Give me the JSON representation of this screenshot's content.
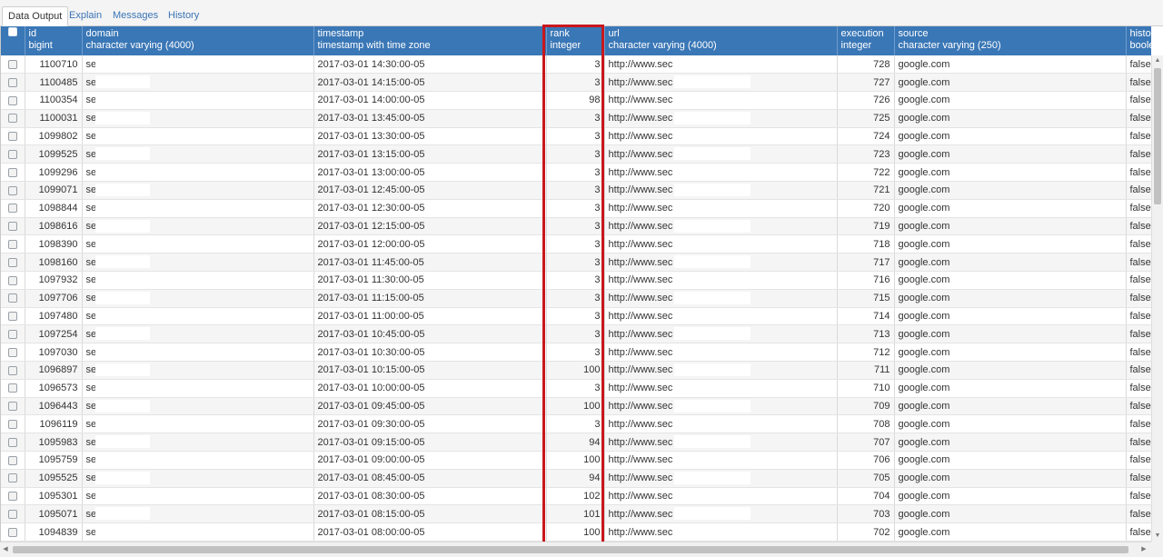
{
  "tabs": [
    {
      "label": "Data Output",
      "active": true
    },
    {
      "label": "Explain",
      "active": false
    },
    {
      "label": "Messages",
      "active": false
    },
    {
      "label": "History",
      "active": false
    }
  ],
  "columns": [
    {
      "name": "id",
      "type": "bigint"
    },
    {
      "name": "domain",
      "type": "character varying (4000)"
    },
    {
      "name": "timestamp",
      "type": "timestamp with time zone"
    },
    {
      "name": "rank",
      "type": "integer"
    },
    {
      "name": "url",
      "type": "character varying (4000)"
    },
    {
      "name": "execution",
      "type": "integer"
    },
    {
      "name": "source",
      "type": "character varying (250)"
    },
    {
      "name": "historica",
      "type": "boolean"
    }
  ],
  "rows": [
    [
      "1100710",
      "se",
      "2017-03-01 14:30:00-05",
      "3",
      "http://www.sec",
      "728",
      "google.com",
      "false"
    ],
    [
      "1100485",
      "se",
      "2017-03-01 14:15:00-05",
      "3",
      "http://www.sec",
      "727",
      "google.com",
      "false"
    ],
    [
      "1100354",
      "se",
      "2017-03-01 14:00:00-05",
      "98",
      "http://www.sec",
      "726",
      "google.com",
      "false"
    ],
    [
      "1100031",
      "se",
      "2017-03-01 13:45:00-05",
      "3",
      "http://www.sec",
      "725",
      "google.com",
      "false"
    ],
    [
      "1099802",
      "se",
      "2017-03-01 13:30:00-05",
      "3",
      "http://www.sec",
      "724",
      "google.com",
      "false"
    ],
    [
      "1099525",
      "se",
      "2017-03-01 13:15:00-05",
      "3",
      "http://www.sec",
      "723",
      "google.com",
      "false"
    ],
    [
      "1099296",
      "se",
      "2017-03-01 13:00:00-05",
      "3",
      "http://www.sec",
      "722",
      "google.com",
      "false"
    ],
    [
      "1099071",
      "se",
      "2017-03-01 12:45:00-05",
      "3",
      "http://www.sec",
      "721",
      "google.com",
      "false"
    ],
    [
      "1098844",
      "se",
      "2017-03-01 12:30:00-05",
      "3",
      "http://www.sec",
      "720",
      "google.com",
      "false"
    ],
    [
      "1098616",
      "se",
      "2017-03-01 12:15:00-05",
      "3",
      "http://www.sec",
      "719",
      "google.com",
      "false"
    ],
    [
      "1098390",
      "se",
      "2017-03-01 12:00:00-05",
      "3",
      "http://www.sec",
      "718",
      "google.com",
      "false"
    ],
    [
      "1098160",
      "se",
      "2017-03-01 11:45:00-05",
      "3",
      "http://www.sec",
      "717",
      "google.com",
      "false"
    ],
    [
      "1097932",
      "se",
      "2017-03-01 11:30:00-05",
      "3",
      "http://www.sec",
      "716",
      "google.com",
      "false"
    ],
    [
      "1097706",
      "se",
      "2017-03-01 11:15:00-05",
      "3",
      "http://www.sec",
      "715",
      "google.com",
      "false"
    ],
    [
      "1097480",
      "se",
      "2017-03-01 11:00:00-05",
      "3",
      "http://www.sec",
      "714",
      "google.com",
      "false"
    ],
    [
      "1097254",
      "se",
      "2017-03-01 10:45:00-05",
      "3",
      "http://www.sec",
      "713",
      "google.com",
      "false"
    ],
    [
      "1097030",
      "se",
      "2017-03-01 10:30:00-05",
      "3",
      "http://www.sec",
      "712",
      "google.com",
      "false"
    ],
    [
      "1096897",
      "se",
      "2017-03-01 10:15:00-05",
      "100",
      "http://www.sec",
      "711",
      "google.com",
      "false"
    ],
    [
      "1096573",
      "se",
      "2017-03-01 10:00:00-05",
      "3",
      "http://www.sec",
      "710",
      "google.com",
      "false"
    ],
    [
      "1096443",
      "se",
      "2017-03-01 09:45:00-05",
      "100",
      "http://www.sec",
      "709",
      "google.com",
      "false"
    ],
    [
      "1096119",
      "se",
      "2017-03-01 09:30:00-05",
      "3",
      "http://www.sec",
      "708",
      "google.com",
      "false"
    ],
    [
      "1095983",
      "se",
      "2017-03-01 09:15:00-05",
      "94",
      "http://www.sec",
      "707",
      "google.com",
      "false"
    ],
    [
      "1095759",
      "se",
      "2017-03-01 09:00:00-05",
      "100",
      "http://www.sec",
      "706",
      "google.com",
      "false"
    ],
    [
      "1095525",
      "se",
      "2017-03-01 08:45:00-05",
      "94",
      "http://www.sec",
      "705",
      "google.com",
      "false"
    ],
    [
      "1095301",
      "se",
      "2017-03-01 08:30:00-05",
      "102",
      "http://www.sec",
      "704",
      "google.com",
      "false"
    ],
    [
      "1095071",
      "se",
      "2017-03-01 08:15:00-05",
      "101",
      "http://www.sec",
      "703",
      "google.com",
      "false"
    ],
    [
      "1094839",
      "se",
      "2017-03-01 08:00:00-05",
      "100",
      "http://www.sec",
      "702",
      "google.com",
      "false"
    ]
  ],
  "colors": {
    "header_bg": "#3a77b6",
    "highlight": "#c8171d",
    "link": "#3a74b5"
  },
  "icons": {
    "select_all": "checkbox-icon",
    "scroll_up": "arrow-up-icon",
    "scroll_down": "arrow-down-icon",
    "scroll_left": "arrow-left-icon",
    "scroll_right": "arrow-right-icon"
  }
}
